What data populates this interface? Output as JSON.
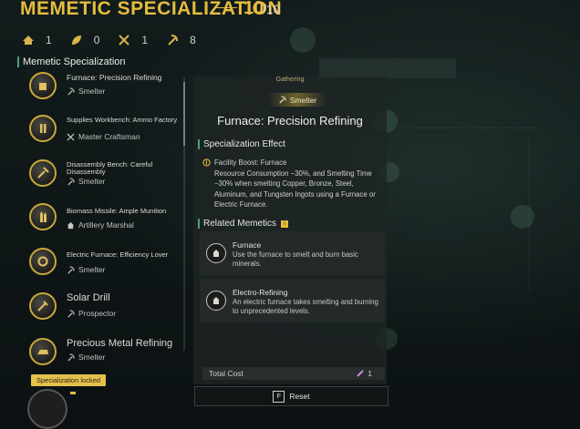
{
  "header": {
    "title": "MEMETIC SPECIALIZATION",
    "count": "10",
    "total": "/10"
  },
  "stats": [
    {
      "icon": "home-icon",
      "value": "1"
    },
    {
      "icon": "leaf-icon",
      "value": "0"
    },
    {
      "icon": "crossed-tools-icon",
      "value": "1"
    },
    {
      "icon": "pickaxe-icon",
      "value": "8"
    }
  ],
  "section_title": "Memetic Specialization",
  "list": [
    {
      "name": "Furnace: Precision Refining",
      "sub": "Smelter",
      "sub_icon": "pickaxe-icon",
      "big": false
    },
    {
      "name": "Supplies Workbench: Ammo Factory",
      "sub": "Master Craftsman",
      "sub_icon": "crossed-tools-icon",
      "big": false
    },
    {
      "name": "Disassembly Bench: Careful Disassembly",
      "sub": "Smelter",
      "sub_icon": "pickaxe-icon",
      "big": false
    },
    {
      "name": "Biomass Missile: Ample Munition",
      "sub": "Artillery Marshal",
      "sub_icon": "home-icon",
      "big": false
    },
    {
      "name": "Electric Furnace: Efficiency Lover",
      "sub": "Smelter",
      "sub_icon": "pickaxe-icon",
      "big": false
    },
    {
      "name": "Solar Drill",
      "sub": "Prospector",
      "sub_icon": "pickaxe-icon",
      "big": true
    },
    {
      "name": "Precious Metal Refining",
      "sub": "Smelter",
      "sub_icon": "pickaxe-icon",
      "big": true
    }
  ],
  "locked_tip": "Specialization locked",
  "detail": {
    "category": "Gathering",
    "tag": "Smelter",
    "title": "Furnace: Precision Refining",
    "effect_heading": "Specialization Effect",
    "effect_label": "Facility Boost: Furnace",
    "effect_body": "Resource Consumption −30%, and Smelting Time −30% when smelting Copper, Bronze, Steel, Aluminum, and Tungsten Ingots using a Furnace or Electric Furnace.",
    "related_heading": "Related Memetics",
    "related": [
      {
        "name": "Furnace",
        "desc": "Use the furnace to smelt and burn basic minerals."
      },
      {
        "name": "Electro-Refining",
        "desc": "An electric furnace takes smelting and burning to unprecedented levels."
      }
    ],
    "total_label": "Total Cost",
    "total_value": "1",
    "reset_key": "F",
    "reset_label": "Reset"
  },
  "colors": {
    "accent": "#e5bc3e",
    "teal": "#4e9c86"
  }
}
